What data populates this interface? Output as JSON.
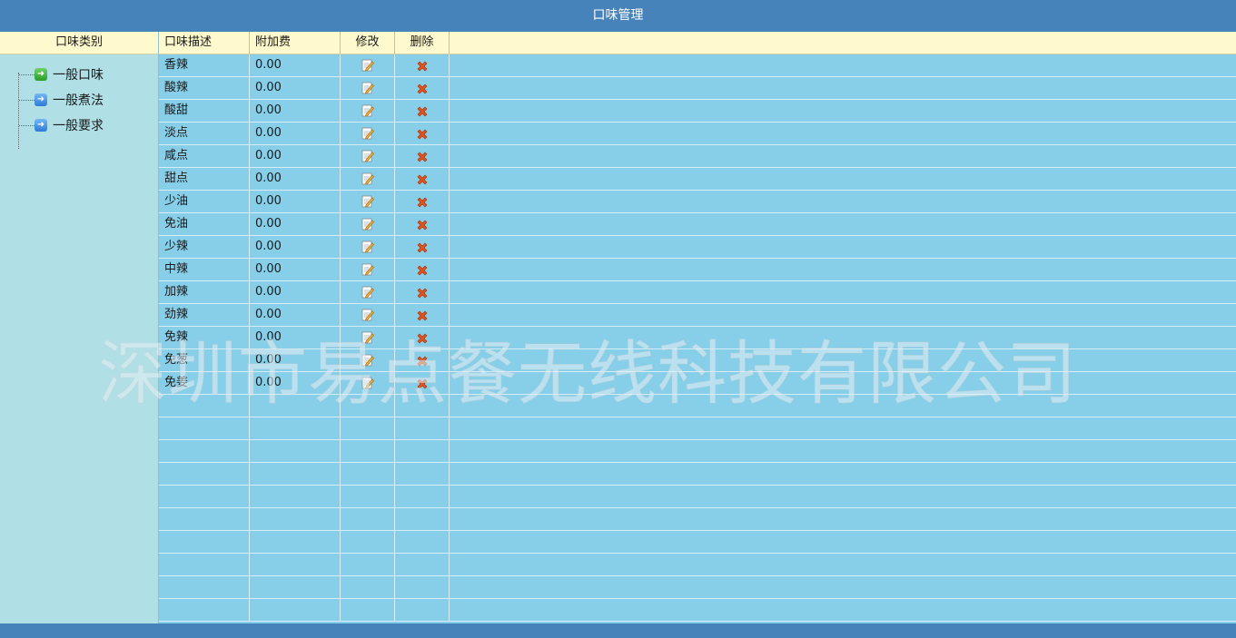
{
  "window": {
    "title": "口味管理"
  },
  "sidebar": {
    "header": "口味类别",
    "items": [
      {
        "label": "一般口味",
        "icon": "green-arrow-icon"
      },
      {
        "label": "一般煮法",
        "icon": "blue-arrow-icon"
      },
      {
        "label": "一般要求",
        "icon": "blue-arrow-icon"
      }
    ]
  },
  "table": {
    "columns": [
      "口味描述",
      "附加费",
      "修改",
      "删除"
    ],
    "rows": [
      {
        "desc": "香辣",
        "fee": "0.00"
      },
      {
        "desc": "酸辣",
        "fee": "0.00"
      },
      {
        "desc": "酸甜",
        "fee": "0.00"
      },
      {
        "desc": "淡点",
        "fee": "0.00"
      },
      {
        "desc": "咸点",
        "fee": "0.00"
      },
      {
        "desc": "甜点",
        "fee": "0.00"
      },
      {
        "desc": "少油",
        "fee": "0.00"
      },
      {
        "desc": "免油",
        "fee": "0.00"
      },
      {
        "desc": "少辣",
        "fee": "0.00"
      },
      {
        "desc": "中辣",
        "fee": "0.00"
      },
      {
        "desc": "加辣",
        "fee": "0.00"
      },
      {
        "desc": "劲辣",
        "fee": "0.00"
      },
      {
        "desc": "免辣",
        "fee": "0.00"
      },
      {
        "desc": "免葱",
        "fee": "0.00"
      },
      {
        "desc": "免姜",
        "fee": "0.00"
      }
    ],
    "empty_rows": 10
  },
  "watermark": "深圳市易点餐无线科技有限公司",
  "colors": {
    "title_bar": "#4783bb",
    "header_bg": "#fffacd",
    "grid_bg": "#87cee8",
    "sidebar_bg": "#b0dfe6",
    "delete_icon": "#e0541c"
  }
}
